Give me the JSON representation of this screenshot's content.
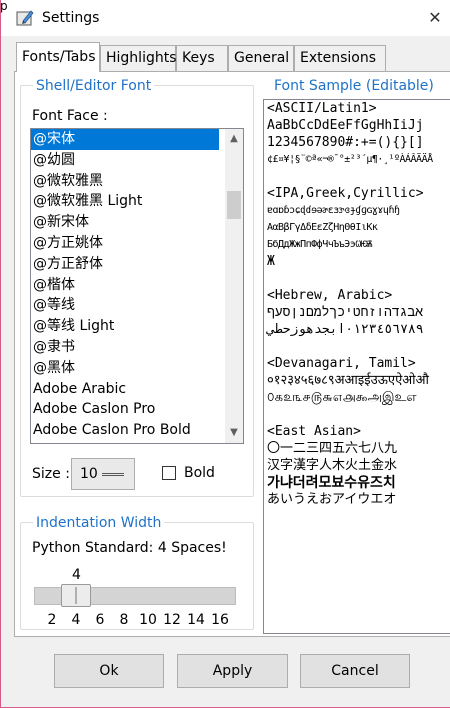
{
  "window": {
    "title": "Settings",
    "corner_glyph": "p"
  },
  "tabs": [
    "Fonts/Tabs",
    "Highlights",
    "Keys",
    "General",
    "Extensions"
  ],
  "font_group": {
    "title": "Shell/Editor Font",
    "face_label": "Font Face :",
    "fonts": [
      "@宋体",
      "@幼圆",
      "@微软雅黑",
      "@微软雅黑 Light",
      "@新宋体",
      "@方正姚体",
      "@方正舒体",
      "@楷体",
      "@等线",
      "@等线 Light",
      "@隶书",
      "@黑体",
      "Adobe Arabic",
      "Adobe Caslon Pro",
      "Adobe Caslon Pro Bold"
    ],
    "selected_index": 0,
    "size_label": "Size :",
    "size_value": "10",
    "bold_label": "Bold",
    "bold_checked": false
  },
  "indent_group": {
    "title": "Indentation Width",
    "standard_text": "Python Standard: 4 Spaces!",
    "current_value": "4",
    "ticks": [
      "2",
      "4",
      "6",
      "8",
      "10",
      "12",
      "14",
      "16"
    ]
  },
  "sample": {
    "title": "Font Sample (Editable)",
    "lines": [
      "<ASCII/Latin1>",
      "AaBbCcDdEeFfGgHhIiJj",
      "1234567890#:+=(){}[]",
      "¢£¤¥¦§¨©ª«¬­®¯°±²³´µ¶·¸¹ºÀÁÂÃÄÅ",
      "",
      "<IPA,Greek,Cyrillic>",
      "ɐɑɒɓɔɕɖɗɘəɚɛɜɝɞɟɠɡɢɣɤɥɦɧ",
      "ΑαΒβΓγΔδΕεΖζΗηΘθΙιΚκ",
      "БбДдЖжПпФфЧчЪъЭэѠѤѬ",
      "Ж",
      "",
      "<Hebrew, Arabic>",
      "אבגדהוזחטיכךלמםנןסעף",
      "٠١٢٣٤٥٦٧٨٩ابجدهوزحطي",
      "",
      "<Devanagari, Tamil>",
      "०१२३४५६७८९अआइईउऊएऐओऔ",
      "௦௧௨௩௪௫௬௭௮௯அஇஉஎ",
      "",
      "<East Asian>",
      "〇一二三四五六七八九",
      "汉字漢字人木火土金水",
      "가냐더려모뵤수유즈치",
      "あいうえおアイウエオ"
    ]
  },
  "buttons": {
    "ok": "Ok",
    "apply": "Apply",
    "cancel": "Cancel"
  }
}
